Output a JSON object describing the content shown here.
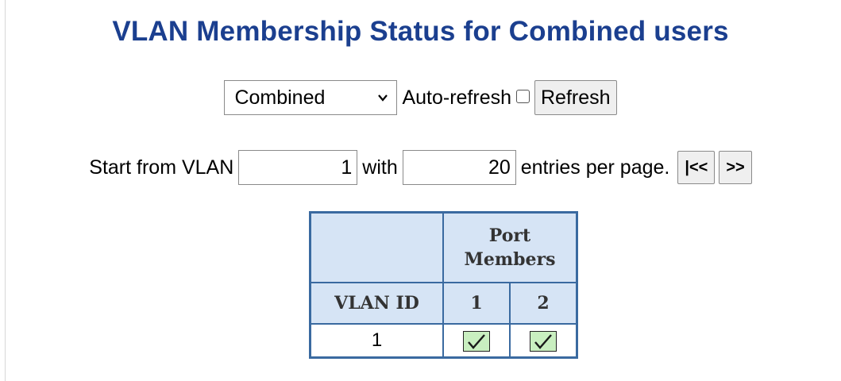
{
  "page": {
    "title": "VLAN Membership Status for Combined users"
  },
  "controls": {
    "user_select": {
      "selected": "Combined",
      "options": [
        "Combined"
      ]
    },
    "auto_refresh_label": "Auto-refresh",
    "auto_refresh_checked": false,
    "refresh_label": "Refresh"
  },
  "pagination": {
    "start_label": "Start from VLAN",
    "start_value": "1",
    "with_label": "with",
    "entries_value": "20",
    "entries_label": "entries per page.",
    "first_button": "|<<",
    "next_button": ">>"
  },
  "table": {
    "group_header": "Port Members",
    "group_header_line1": "Port",
    "group_header_line2": "Members",
    "vlan_id_header": "VLAN ID",
    "port_headers": [
      "1",
      "2"
    ],
    "rows": [
      {
        "vlan_id": "1",
        "ports": [
          true,
          true
        ]
      }
    ]
  },
  "colors": {
    "title": "#1b3f8f",
    "table_border": "#3a6aa0",
    "header_bg": "#d6e4f5",
    "member_tick_bg": "#c9efc0"
  }
}
